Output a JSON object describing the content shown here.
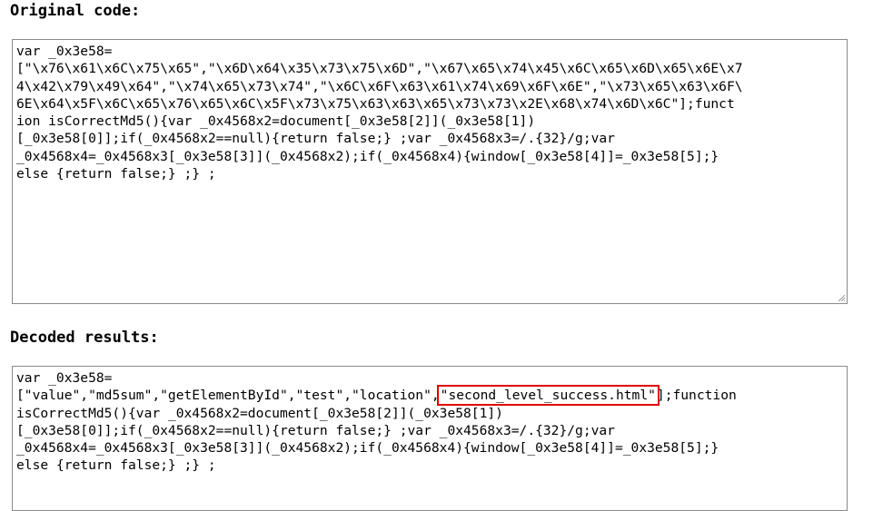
{
  "headings": {
    "original": "Original code:",
    "decoded": "Decoded results:"
  },
  "original_code": {
    "lines": [
      "var _0x3e58=",
      "[\"\\x76\\x61\\x6C\\x75\\x65\",\"\\x6D\\x64\\x35\\x73\\x75\\x6D\",\"\\x67\\x65\\x74\\x45\\x6C\\x65\\x6D\\x65\\x6E\\x7",
      "4\\x42\\x79\\x49\\x64\",\"\\x74\\x65\\x73\\x74\",\"\\x6C\\x6F\\x63\\x61\\x74\\x69\\x6F\\x6E\",\"\\x73\\x65\\x63\\x6F\\",
      "6E\\x64\\x5F\\x6C\\x65\\x76\\x65\\x6C\\x5F\\x73\\x75\\x63\\x63\\x65\\x73\\x73\\x2E\\x68\\x74\\x6D\\x6C\"];funct",
      "ion isCorrectMd5(){var _0x4568x2=document[_0x3e58[2]](_0x3e58[1])",
      "[_0x3e58[0]];if(_0x4568x2==null){return false;} ;var _0x4568x3=/.{32}/g;var",
      "_0x4568x4=_0x4568x3[_0x3e58[3]](_0x4568x2);if(_0x4568x4){window[_0x3e58[4]]=_0x3e58[5];}",
      "else {return false;} ;} ;"
    ]
  },
  "decoded_code": {
    "line1": "var _0x3e58=",
    "line2_before": "[\"value\",\"md5sum\",\"getElementById\",\"test\",\"location\",",
    "line2_highlight": "\"second_level_success.html\"",
    "line2_after": "];function",
    "line3": "isCorrectMd5(){var _0x4568x2=document[_0x3e58[2]](_0x3e58[1])",
    "line4": "[_0x3e58[0]];if(_0x4568x2==null){return false;} ;var _0x4568x3=/.{32}/g;var",
    "line5": "_0x4568x4=_0x4568x3[_0x3e58[3]](_0x4568x2);if(_0x4568x4){window[_0x3e58[4]]=_0x3e58[5];}",
    "line6": "else {return false;} ;} ;"
  },
  "colors": {
    "highlight": "#e00000",
    "border": "#8a8a8a"
  }
}
